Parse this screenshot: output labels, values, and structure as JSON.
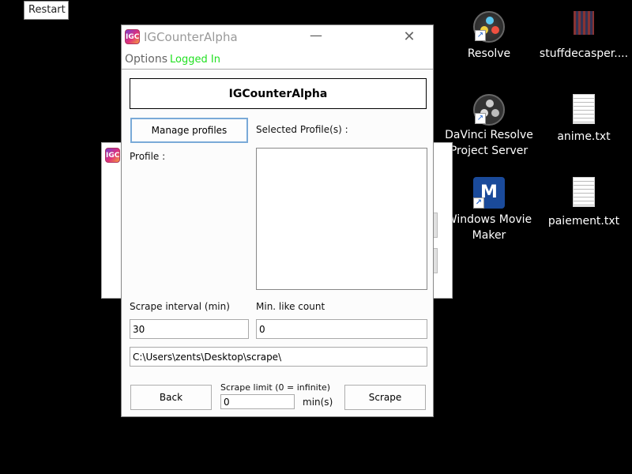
{
  "desktop": {
    "restart_label": "Restart",
    "icons": [
      {
        "label_lines": [
          "Resolve"
        ],
        "icon": "davinci-resolve-icon"
      },
      {
        "label_lines": [
          "stuffdecasper...."
        ],
        "icon": "image-thumbnail-icon"
      },
      {
        "label_lines": [
          "DaVinci Resolve",
          "Project Server"
        ],
        "icon": "davinci-project-server-icon"
      },
      {
        "label_lines": [
          "anime.txt"
        ],
        "icon": "text-file-icon"
      },
      {
        "label_lines": [
          "Windows Movie",
          "Maker"
        ],
        "icon": "movie-maker-icon"
      },
      {
        "label_lines": [
          "paiement.txt"
        ],
        "icon": "text-file-icon"
      }
    ]
  },
  "window": {
    "app_icon_text": "IGC",
    "title": "IGCounterAlpha",
    "menu": {
      "options": "Options",
      "status": "Logged In",
      "status_color": "#22e022"
    },
    "header": "IGCounterAlpha",
    "manage_profiles": "Manage profiles",
    "selected_profiles_label": "Selected Profile(s) :",
    "profile_label": "Profile :",
    "scrape_interval_label": "Scrape interval (min)",
    "scrape_interval_value": "30",
    "min_like_label": "Min. like count",
    "min_like_value": "0",
    "path_value": "C:\\Users\\zents\\Desktop\\scrape\\",
    "back": "Back",
    "scrape_limit_label": "Scrape limit (0 = infinite)",
    "scrape_limit_value": "0",
    "scrape_limit_unit": "min(s)",
    "scrape": "Scrape"
  }
}
